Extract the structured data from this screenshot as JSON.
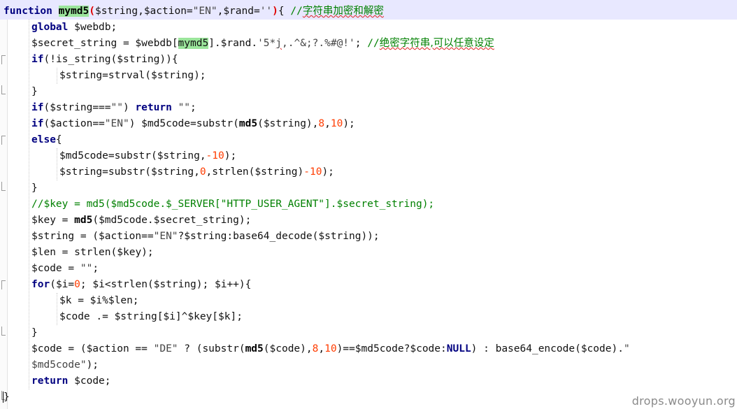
{
  "editor": {
    "language": "php",
    "lines": [
      [
        [
          "kw",
          "function"
        ],
        [
          "op",
          " "
        ],
        [
          "fn-hl",
          "mymd5"
        ],
        [
          "brace-red",
          "("
        ],
        [
          "var",
          "$string"
        ],
        [
          "op",
          ","
        ],
        [
          "var",
          "$action"
        ],
        [
          "op",
          "="
        ],
        [
          "str",
          "\"EN\""
        ],
        [
          "op",
          ","
        ],
        [
          "var",
          "$rand"
        ],
        [
          "op",
          "="
        ],
        [
          "str",
          "''"
        ],
        [
          "brace-red",
          ")"
        ],
        [
          "op",
          "{ "
        ],
        [
          "cm",
          "//"
        ],
        [
          "cm-sq",
          "字符串加密和解密"
        ]
      ],
      [
        [
          "kw",
          "global"
        ],
        [
          "op",
          " "
        ],
        [
          "var",
          "$webdb"
        ],
        [
          "op",
          ";"
        ]
      ],
      [
        [
          "var",
          "$secret_string"
        ],
        [
          "op",
          " = "
        ],
        [
          "var",
          "$webdb"
        ],
        [
          "op",
          "["
        ],
        [
          "fn-hl-plain",
          "mymd5"
        ],
        [
          "op",
          "]."
        ],
        [
          "var",
          "$rand"
        ],
        [
          "op",
          "."
        ],
        [
          "str",
          "'5*"
        ],
        [
          "str-sq",
          "j"
        ],
        [
          "str",
          ",.^&;?.%#@!'"
        ],
        [
          "op",
          "; "
        ],
        [
          "cm",
          "//"
        ],
        [
          "cm-sq",
          "绝密字符串,可以任意设定"
        ]
      ],
      [
        [
          "kw",
          "if"
        ],
        [
          "op",
          "(!"
        ],
        [
          "var",
          "is_string"
        ],
        [
          "op",
          "("
        ],
        [
          "var",
          "$string"
        ],
        [
          "op",
          ")){"
        ]
      ],
      [
        [
          "var",
          "$string"
        ],
        [
          "op",
          "="
        ],
        [
          "var",
          "strval"
        ],
        [
          "op",
          "("
        ],
        [
          "var",
          "$string"
        ],
        [
          "op",
          ");"
        ]
      ],
      [
        [
          "op",
          "}"
        ]
      ],
      [
        [
          "kw",
          "if"
        ],
        [
          "op",
          "("
        ],
        [
          "var",
          "$string"
        ],
        [
          "op",
          "==="
        ],
        [
          "str",
          "\"\""
        ],
        [
          "op",
          ") "
        ],
        [
          "kw",
          "return"
        ],
        [
          "op",
          " "
        ],
        [
          "str",
          "\"\""
        ],
        [
          "op",
          ";"
        ]
      ],
      [
        [
          "kw",
          "if"
        ],
        [
          "op",
          "("
        ],
        [
          "var",
          "$action"
        ],
        [
          "op",
          "=="
        ],
        [
          "str",
          "\"EN\""
        ],
        [
          "op",
          ") "
        ],
        [
          "var",
          "$md5code"
        ],
        [
          "op",
          "="
        ],
        [
          "var",
          "substr"
        ],
        [
          "op",
          "("
        ],
        [
          "fn",
          "md5"
        ],
        [
          "op",
          "("
        ],
        [
          "var",
          "$string"
        ],
        [
          "op",
          "),"
        ],
        [
          "num",
          "8"
        ],
        [
          "op",
          ","
        ],
        [
          "num",
          "10"
        ],
        [
          "op",
          ");"
        ]
      ],
      [
        [
          "kw",
          "else"
        ],
        [
          "op",
          "{"
        ]
      ],
      [
        [
          "var",
          "$md5code"
        ],
        [
          "op",
          "="
        ],
        [
          "var",
          "substr"
        ],
        [
          "op",
          "("
        ],
        [
          "var",
          "$string"
        ],
        [
          "op",
          ","
        ],
        [
          "num",
          "-10"
        ],
        [
          "op",
          ");"
        ]
      ],
      [
        [
          "var",
          "$string"
        ],
        [
          "op",
          "="
        ],
        [
          "var",
          "substr"
        ],
        [
          "op",
          "("
        ],
        [
          "var",
          "$string"
        ],
        [
          "op",
          ","
        ],
        [
          "num",
          "0"
        ],
        [
          "op",
          ","
        ],
        [
          "var",
          "strlen"
        ],
        [
          "op",
          "("
        ],
        [
          "var",
          "$string"
        ],
        [
          "op",
          ")"
        ],
        [
          "num",
          "-10"
        ],
        [
          "op",
          ");"
        ]
      ],
      [
        [
          "op",
          "}"
        ]
      ],
      [
        [
          "cm",
          "//$key = md5($md5code.$_SERVER[\"HTTP_USER_AGENT\"].$secret_string);"
        ]
      ],
      [
        [
          "var",
          "$key"
        ],
        [
          "op",
          " = "
        ],
        [
          "fn",
          "md5"
        ],
        [
          "op",
          "("
        ],
        [
          "var",
          "$md5code"
        ],
        [
          "op",
          "."
        ],
        [
          "var",
          "$secret_string"
        ],
        [
          "op",
          ");"
        ]
      ],
      [
        [
          "var",
          "$string"
        ],
        [
          "op",
          " = ("
        ],
        [
          "var",
          "$action"
        ],
        [
          "op",
          "=="
        ],
        [
          "str",
          "\"EN\""
        ],
        [
          "op",
          "?"
        ],
        [
          "var",
          "$string"
        ],
        [
          "op",
          ":"
        ],
        [
          "var",
          "base64_decode"
        ],
        [
          "op",
          "("
        ],
        [
          "var",
          "$string"
        ],
        [
          "op",
          "));"
        ]
      ],
      [
        [
          "var",
          "$len"
        ],
        [
          "op",
          " = "
        ],
        [
          "var",
          "strlen"
        ],
        [
          "op",
          "("
        ],
        [
          "var",
          "$key"
        ],
        [
          "op",
          ");"
        ]
      ],
      [
        [
          "var",
          "$code"
        ],
        [
          "op",
          " = "
        ],
        [
          "str",
          "\"\""
        ],
        [
          "op",
          ";"
        ]
      ],
      [
        [
          "kw",
          "for"
        ],
        [
          "op",
          "("
        ],
        [
          "var",
          "$i"
        ],
        [
          "op",
          "="
        ],
        [
          "num",
          "0"
        ],
        [
          "op",
          "; "
        ],
        [
          "var",
          "$i"
        ],
        [
          "op",
          "<"
        ],
        [
          "var",
          "strlen"
        ],
        [
          "op",
          "("
        ],
        [
          "var",
          "$string"
        ],
        [
          "op",
          "); "
        ],
        [
          "var",
          "$i"
        ],
        [
          "op",
          "++){"
        ]
      ],
      [
        [
          "var",
          "$k"
        ],
        [
          "op",
          " = "
        ],
        [
          "var",
          "$i"
        ],
        [
          "op",
          "%"
        ],
        [
          "var",
          "$len"
        ],
        [
          "op",
          ";"
        ]
      ],
      [
        [
          "var",
          "$code"
        ],
        [
          "op",
          " .= "
        ],
        [
          "var",
          "$string"
        ],
        [
          "op",
          "["
        ],
        [
          "var",
          "$i"
        ],
        [
          "op",
          "]^"
        ],
        [
          "var",
          "$key"
        ],
        [
          "op",
          "["
        ],
        [
          "var",
          "$k"
        ],
        [
          "op",
          "];"
        ]
      ],
      [
        [
          "op",
          "}"
        ]
      ],
      [
        [
          "var",
          "$code"
        ],
        [
          "op",
          " = ("
        ],
        [
          "var",
          "$action"
        ],
        [
          "op",
          " == "
        ],
        [
          "str",
          "\"DE\""
        ],
        [
          "op",
          " ? ("
        ],
        [
          "var",
          "substr"
        ],
        [
          "op",
          "("
        ],
        [
          "fn",
          "md5"
        ],
        [
          "op",
          "("
        ],
        [
          "var",
          "$code"
        ],
        [
          "op",
          "),"
        ],
        [
          "num",
          "8"
        ],
        [
          "op",
          ","
        ],
        [
          "num",
          "10"
        ],
        [
          "op",
          ")=="
        ],
        [
          "var",
          "$md5code"
        ],
        [
          "op",
          "?"
        ],
        [
          "var",
          "$code"
        ],
        [
          "op",
          ":"
        ],
        [
          "kw",
          "NULL"
        ],
        [
          "op",
          ") : "
        ],
        [
          "var",
          "base64_encode"
        ],
        [
          "op",
          "("
        ],
        [
          "var",
          "$code"
        ],
        [
          "op",
          ")."
        ],
        [
          "str",
          "\""
        ]
      ],
      [
        [
          "str",
          "$md5code\""
        ],
        [
          "op",
          ");"
        ]
      ],
      [
        [
          "kw",
          "return"
        ],
        [
          "op",
          " "
        ],
        [
          "var",
          "$code"
        ],
        [
          "op",
          ";"
        ]
      ],
      [
        [
          "op",
          "}"
        ]
      ]
    ]
  },
  "watermark": "drops.wooyun.org"
}
